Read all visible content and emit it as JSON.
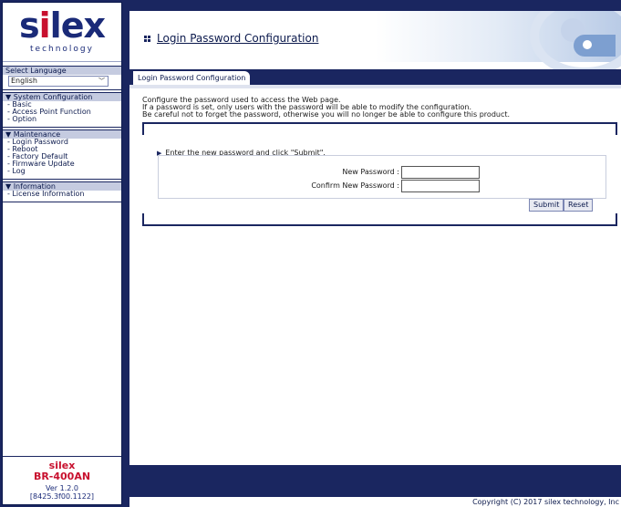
{
  "logo": {
    "word_pre": "s",
    "word_i": "i",
    "word_post": "lex",
    "sub": "technology"
  },
  "language": {
    "header": "Select Language",
    "selected": "English"
  },
  "menu": {
    "system": {
      "header": "▼ System Configuration",
      "items": [
        "- Basic",
        "- Access Point Function",
        "- Option"
      ]
    },
    "maintenance": {
      "header": "▼ Maintenance",
      "items": [
        "- Login Password",
        "- Reboot",
        "- Factory Default",
        "- Firmware Update",
        "- Log"
      ]
    },
    "information": {
      "header": "▼ Information",
      "items": [
        "- License Information"
      ]
    }
  },
  "footer": {
    "brand": "silex",
    "model": "BR-400AN",
    "version": "Ver 1.2.0",
    "build": "[8425.3f00.1122]"
  },
  "page": {
    "title": "Login Password Configuration",
    "tab": "Login Password Configuration",
    "desc1": "Configure the password used to access the Web page.",
    "desc2": "If a password is set, only users with the password will be able to modify the configuration.",
    "desc3": "Be careful not to forget the password, otherwise you will no longer be able to configure this product.",
    "instruction": "Enter the new password and click \"Submit\".",
    "new_password_label": "New Password :",
    "confirm_password_label": "Confirm New Password :",
    "new_password_value": "",
    "confirm_password_value": "",
    "submit_label": "Submit",
    "reset_label": "Reset",
    "copyright": "Copyright (C) 2017 silex technology, Inc"
  },
  "colors": {
    "navy": "#1a2660",
    "brand_red": "#c8102e",
    "menu_header": "#c5cbe0"
  }
}
